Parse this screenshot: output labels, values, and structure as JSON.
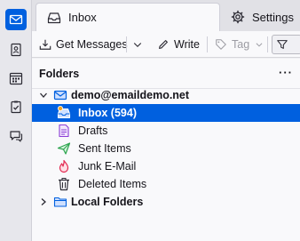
{
  "tabs": [
    {
      "label": "Inbox",
      "icon": "inbox-icon"
    },
    {
      "label": "Settings",
      "icon": "gear-icon"
    }
  ],
  "toolbar": {
    "get_messages": "Get Messages",
    "write": "Write",
    "tag": "Tag"
  },
  "folder_pane": {
    "title": "Folders",
    "menu": "···",
    "account": "demo@emailde​mo.net",
    "folders": [
      {
        "label": "Inbox (594)",
        "icon": "inbox-icon",
        "selected": true
      },
      {
        "label": "Drafts",
        "icon": "drafts-icon"
      },
      {
        "label": "Sent Items",
        "icon": "sent-icon"
      },
      {
        "label": "Junk E-Mail",
        "icon": "junk-icon"
      },
      {
        "label": "Deleted Items",
        "icon": "trash-icon"
      }
    ],
    "local_folders": "Local Folders"
  },
  "colors": {
    "accent": "#0060df",
    "sent": "#2ea44f",
    "junk": "#e22850",
    "drafts": "#8c3fd6",
    "unread_dot": "#f5a623"
  }
}
